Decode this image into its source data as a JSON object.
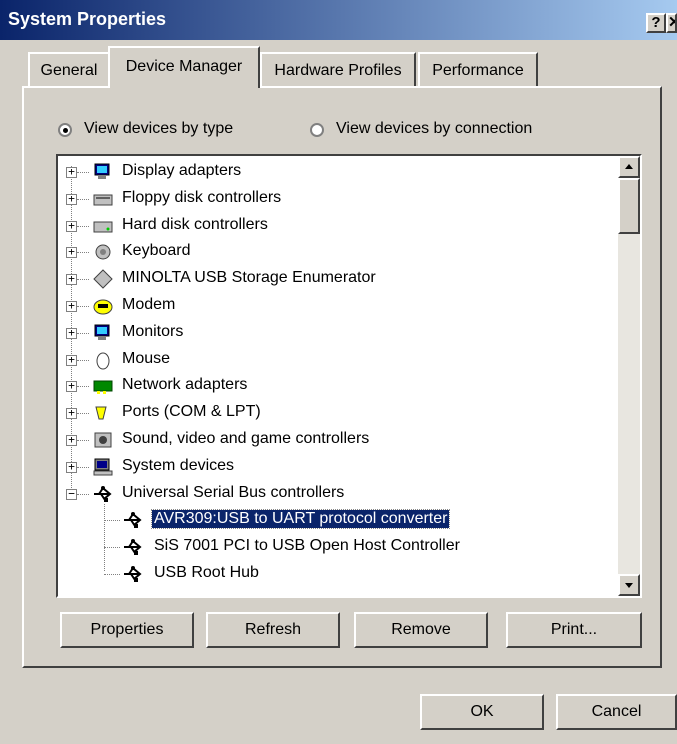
{
  "window": {
    "title": "System Properties",
    "help": "?",
    "close": "✕"
  },
  "tabs": [
    {
      "label": "General"
    },
    {
      "label": "Device Manager"
    },
    {
      "label": "Hardware Profiles"
    },
    {
      "label": "Performance"
    }
  ],
  "view": {
    "by_type": "View devices by type",
    "by_connection": "View devices by connection",
    "selected": "by_type"
  },
  "devices": [
    {
      "label": "Display adapters",
      "icon": "display-icon"
    },
    {
      "label": "Floppy disk controllers",
      "icon": "floppy-controller-icon"
    },
    {
      "label": "Hard disk controllers",
      "icon": "hard-disk-controller-icon"
    },
    {
      "label": "Keyboard",
      "icon": "keyboard-icon"
    },
    {
      "label": "MINOLTA USB Storage Enumerator",
      "icon": "diamond-icon"
    },
    {
      "label": "Modem",
      "icon": "modem-icon"
    },
    {
      "label": "Monitors",
      "icon": "monitor-icon"
    },
    {
      "label": "Mouse",
      "icon": "mouse-icon"
    },
    {
      "label": "Network adapters",
      "icon": "network-adapter-icon"
    },
    {
      "label": "Ports (COM & LPT)",
      "icon": "port-icon"
    },
    {
      "label": "Sound, video and game controllers",
      "icon": "sound-icon"
    },
    {
      "label": "System devices",
      "icon": "system-devices-icon"
    },
    {
      "label": "Universal Serial Bus controllers",
      "icon": "usb-icon"
    }
  ],
  "usb_children": [
    {
      "label": "AVR309:USB to UART protocol converter",
      "icon": "usb-icon",
      "selected": true
    },
    {
      "label": "SiS 7001 PCI to USB Open Host Controller",
      "icon": "usb-icon"
    },
    {
      "label": "USB Root Hub",
      "icon": "usb-icon"
    }
  ],
  "buttons": {
    "properties": "Properties",
    "refresh": "Refresh",
    "remove": "Remove",
    "print": "Print...",
    "ok": "OK",
    "cancel": "Cancel"
  },
  "colors": {
    "face": "#d4d0c8",
    "title": "#0a246a",
    "selection": "#0a246a"
  }
}
